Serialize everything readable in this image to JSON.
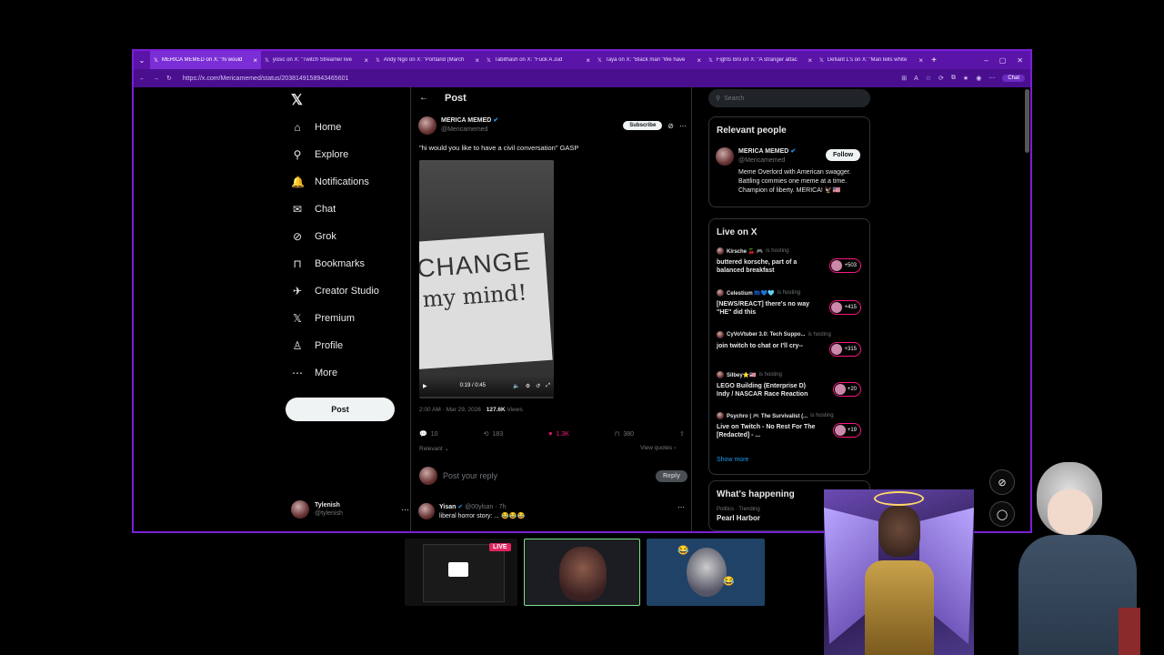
{
  "browser": {
    "tabs": [
      {
        "title": "MERICA MEMED on X: \"hi would"
      },
      {
        "title": "yosic on X: \"Twitch Streamer live"
      },
      {
        "title": "Andy Ngo on X: \"Portland (March"
      },
      {
        "title": "Tabithash on X: \"Fuck A Jud"
      },
      {
        "title": "Taya on X: \"Black man \"We have"
      },
      {
        "title": "Fights Bro on X: \"A stranger attac"
      },
      {
        "title": "Defiant L's on X: \"Man tells white"
      }
    ],
    "url": "https://x.com/Mericamemed/status/2038149158943465601",
    "chat_label": "Chat"
  },
  "nav": {
    "items": [
      {
        "label": "Home",
        "icon": "⌂"
      },
      {
        "label": "Explore",
        "icon": "⚲"
      },
      {
        "label": "Notifications",
        "icon": "🔔"
      },
      {
        "label": "Chat",
        "icon": "✉"
      },
      {
        "label": "Grok",
        "icon": "⊘"
      },
      {
        "label": "Bookmarks",
        "icon": "⊓"
      },
      {
        "label": "Creator Studio",
        "icon": "✈"
      },
      {
        "label": "Premium",
        "icon": "𝕏"
      },
      {
        "label": "Profile",
        "icon": "♙"
      },
      {
        "label": "More",
        "icon": "⋯"
      }
    ],
    "post_label": "Post",
    "account": {
      "name": "Tylenish",
      "handle": "@tylenish"
    }
  },
  "post": {
    "header": "Post",
    "author_name": "MERICA MEMED",
    "author_handle": "@Mericamemed",
    "subscribe_label": "Subscribe",
    "text": "\"hi would you like to have a civil conversation\" GASP",
    "sign_line1": "CHANGE",
    "sign_line2": "my mind!",
    "video_time": "0:19 / 0:45",
    "timestamp": "2:00 AM · Mar 29, 2026",
    "views": "127.6K",
    "views_label": "Views",
    "replies": "10",
    "reposts": "183",
    "likes": "1.3K",
    "bookmarks": "380",
    "sort_label": "Relevant ⌄",
    "view_quotes": "View quotes ›",
    "reply_placeholder": "Post your reply",
    "reply_button": "Reply",
    "first_reply": {
      "name": "Yisan",
      "handle": "@00ylsan · 7h",
      "text": "liberal horror story: ... 😂😂😂"
    }
  },
  "sidebar": {
    "search_placeholder": "Search",
    "relevant_title": "Relevant people",
    "person": {
      "name": "MERICA MEMED",
      "handle": "@Mericamemed",
      "bio": "Meme Overlord with American swagger. Battling commies one meme at a time. Champion of liberty. MERICA! 🦅🇺🇸",
      "follow_label": "Follow"
    },
    "live_title": "Live on X",
    "live": [
      {
        "host": "Kirsche 🍒 🎮",
        "status": "is hosting",
        "title": "buttered korsche, part of a balanced breakfast",
        "count": "+503"
      },
      {
        "host": "Celestium 🇪🇺💙🩵",
        "status": "is hosting",
        "title": "[NEWS/REACT] there's no way \"HE\" did this",
        "count": "+415"
      },
      {
        "host": "CyVoVtuber 3.0: Tech Suppo...",
        "status": "is hosting",
        "title": "join twitch to chat or I'll cry--",
        "count": "+315"
      },
      {
        "host": "Silbey⭐🇺🇸",
        "status": "is hosting",
        "title": "LEGO Building (Enterprise D) Indy / NASCAR Race Reaction",
        "count": "+20"
      },
      {
        "host": "Psychro | 🎮 The Survivalist (...",
        "status": "is hosting",
        "title": "Live on Twitch - No Rest For The [Redacted] - ...",
        "count": "+19"
      }
    ],
    "show_more": "Show more",
    "happening_title": "What's happening",
    "trend_category": "Politics · Trending",
    "trend_name": "Pearl Harbor"
  },
  "overlay": {
    "live_badge": "LIVE"
  }
}
